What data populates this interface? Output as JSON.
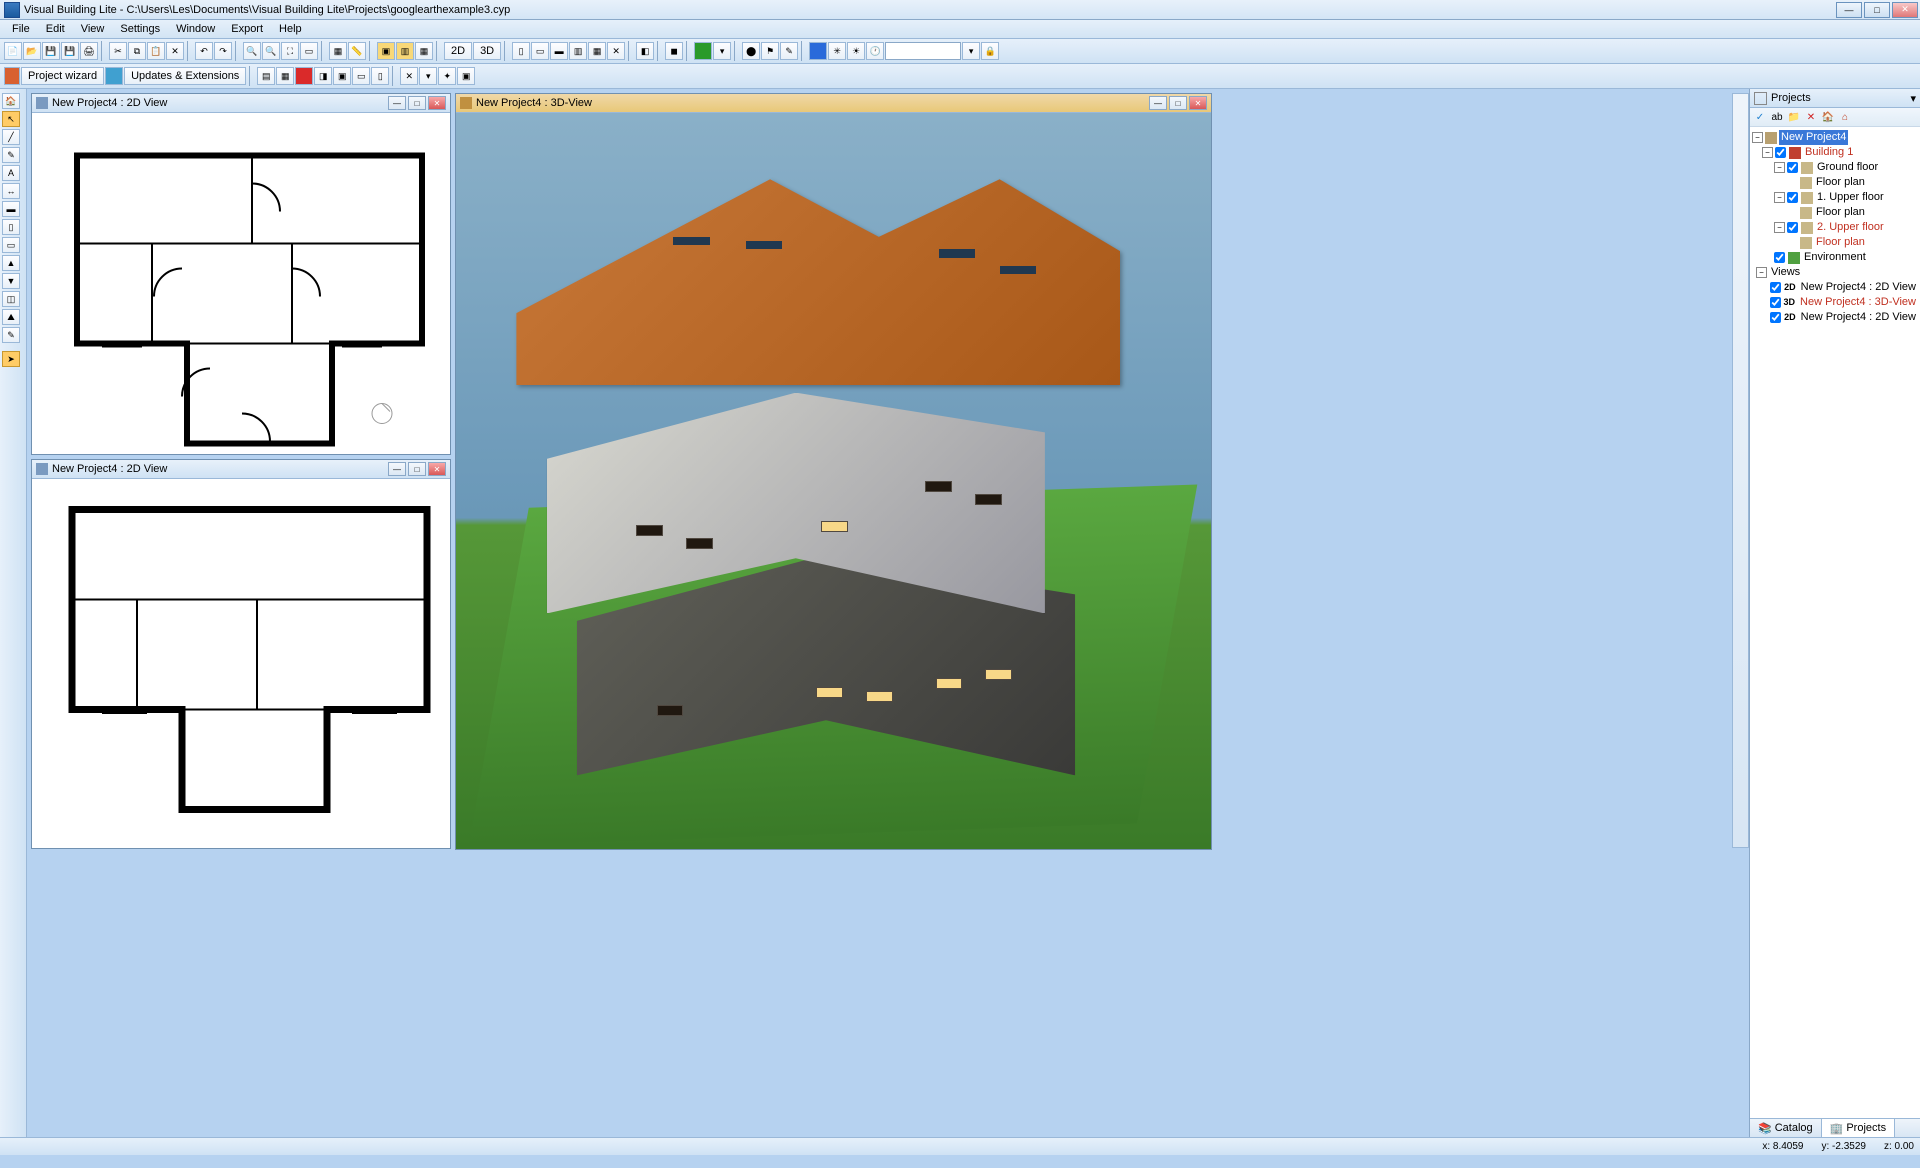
{
  "titlebar": {
    "title": "Visual Building Lite - C:\\Users\\Les\\Documents\\Visual Building Lite\\Projects\\googlearthexample3.cyp"
  },
  "menu": [
    "File",
    "Edit",
    "View",
    "Settings",
    "Window",
    "Export",
    "Help"
  ],
  "toolbar2": {
    "project_wizard": "Project wizard",
    "updates": "Updates & Extensions",
    "mode2d": "2D",
    "mode3d": "3D"
  },
  "windows": {
    "w2d_a": "New Project4 : 2D View",
    "w2d_b": "New Project4 : 2D View",
    "w3d": "New Project4 : 3D-View"
  },
  "projects_panel": {
    "title": "Projects",
    "root": "New Project4",
    "building": "Building 1",
    "ground_floor": "Ground floor",
    "floor_plan": "Floor plan",
    "upper1": "1. Upper floor",
    "upper2": "2. Upper floor",
    "environment": "Environment",
    "views": "Views",
    "view_2d_a": "New Project4 : 2D View",
    "view_3d": "New Project4 : 3D-View",
    "view_2d_b": "New Project4 : 2D View",
    "badge2d": "2D",
    "badge3d": "3D"
  },
  "bottom_tabs": {
    "catalog": "Catalog",
    "projects": "Projects"
  },
  "status": {
    "x": "x: 8.4059",
    "y": "y: -2.3529",
    "z": "z: 0.00"
  }
}
